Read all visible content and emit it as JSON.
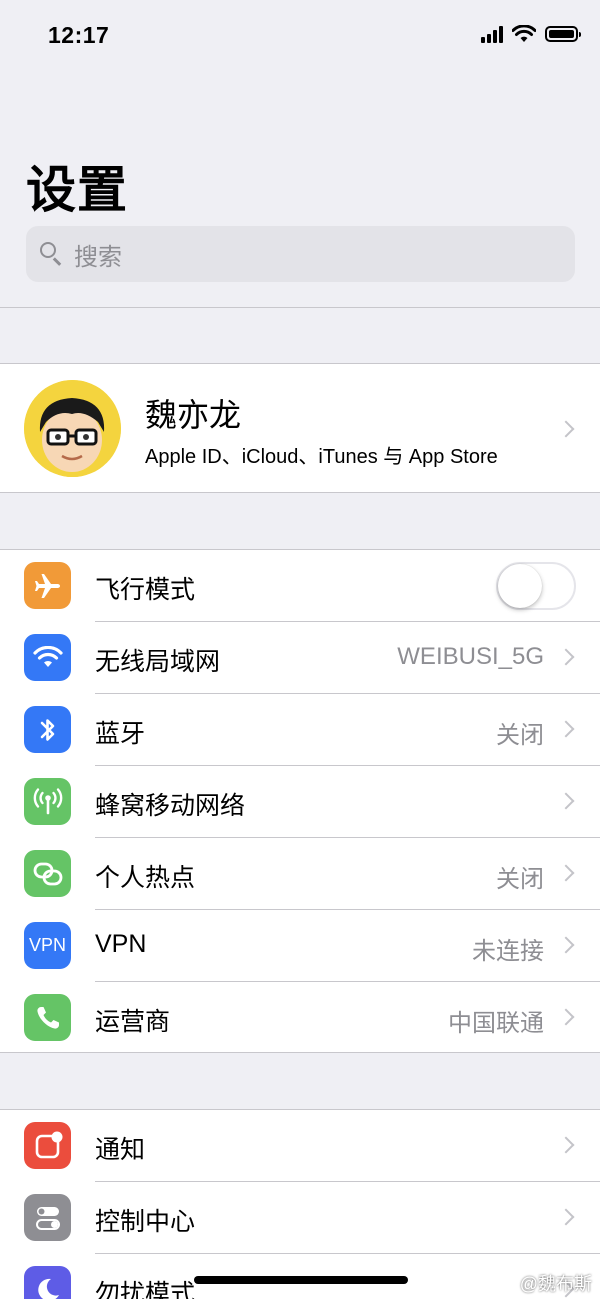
{
  "status_bar": {
    "time": "12:17"
  },
  "header": {
    "title": "设置"
  },
  "search": {
    "placeholder": "搜索"
  },
  "profile": {
    "name": "魏亦龙",
    "subtitle": "Apple ID、iCloud、iTunes 与 App Store"
  },
  "network_group": [
    {
      "label": "飞行模式",
      "value": "",
      "icon": "airplane-icon",
      "color": "#f19a38",
      "toggle_on": false
    },
    {
      "label": "无线局域网",
      "value": "WEIBUSI_5G",
      "icon": "wifi-icon",
      "color": "#3478f6"
    },
    {
      "label": "蓝牙",
      "value": "关闭",
      "icon": "bluetooth-icon",
      "color": "#3478f6"
    },
    {
      "label": "蜂窝移动网络",
      "value": "",
      "icon": "cellular-icon",
      "color": "#65c466"
    },
    {
      "label": "个人热点",
      "value": "关闭",
      "icon": "hotspot-icon",
      "color": "#65c466"
    },
    {
      "label": "VPN",
      "value": "未连接",
      "icon": "vpn-icon",
      "icon_text": "VPN",
      "color": "#3478f6"
    },
    {
      "label": "运营商",
      "value": "中国联通",
      "icon": "phone-icon",
      "color": "#65c466"
    }
  ],
  "system_group": [
    {
      "label": "通知",
      "icon": "notifications-icon",
      "color": "#eb4d3d"
    },
    {
      "label": "控制中心",
      "icon": "control-center-icon",
      "color": "#8e8e93"
    },
    {
      "label": "勿扰模式",
      "icon": "moon-icon",
      "color": "#5e5ce6"
    }
  ],
  "watermark": "@魏布斯"
}
